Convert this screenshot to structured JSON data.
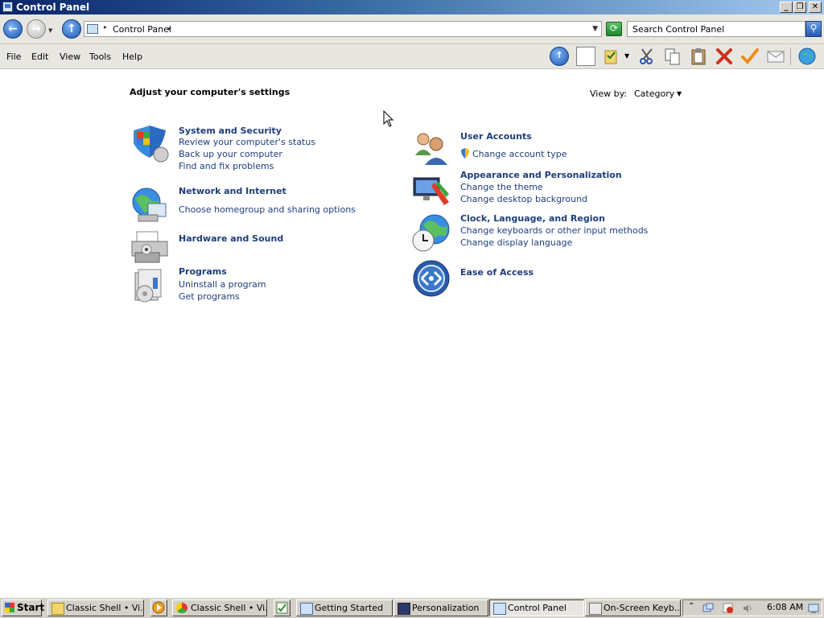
{
  "window": {
    "title": "Control Panel",
    "caption_buttons": [
      "minimize",
      "maximize",
      "close"
    ]
  },
  "address_bar": {
    "path_text": "Control Panel",
    "search_placeholder": "Search Control Panel"
  },
  "menu": {
    "items": [
      "File",
      "Edit",
      "View",
      "Tools",
      "Help"
    ]
  },
  "content": {
    "heading": "Adjust your computer's settings",
    "view_by_label": "View by:",
    "view_by_value": "Category",
    "categories_left": [
      {
        "title": "System and Security",
        "icon": "shield-icon",
        "links": [
          "Review your computer's status",
          "Back up your computer",
          "Find and fix problems"
        ]
      },
      {
        "title": "Network and Internet",
        "icon": "network-globe-icon",
        "links": [
          "Choose homegroup and sharing options"
        ]
      },
      {
        "title": "Hardware and Sound",
        "icon": "printer-icon",
        "links": []
      },
      {
        "title": "Programs",
        "icon": "programs-box-icon",
        "links": [
          "Uninstall a program",
          "Get programs"
        ]
      }
    ],
    "categories_right": [
      {
        "title": "User Accounts",
        "icon": "users-icon",
        "links": [
          "Change account type"
        ]
      },
      {
        "title": "Appearance and Personalization",
        "icon": "monitor-paint-icon",
        "links": [
          "Change the theme",
          "Change desktop background"
        ]
      },
      {
        "title": "Clock, Language, and Region",
        "icon": "clock-globe-icon",
        "links": [
          "Change keyboards or other input methods",
          "Change display language"
        ]
      },
      {
        "title": "Ease of Access",
        "icon": "ease-of-access-icon",
        "links": []
      }
    ]
  },
  "taskbar": {
    "start_label": "Start",
    "buttons": [
      "Classic Shell • Vi...",
      "Classic Shell • Vi...",
      "Getting Started",
      "Personalization",
      "Control Panel",
      "On-Screen Keyb..."
    ],
    "active_button": "Control Panel",
    "clock": "6:08 AM"
  }
}
